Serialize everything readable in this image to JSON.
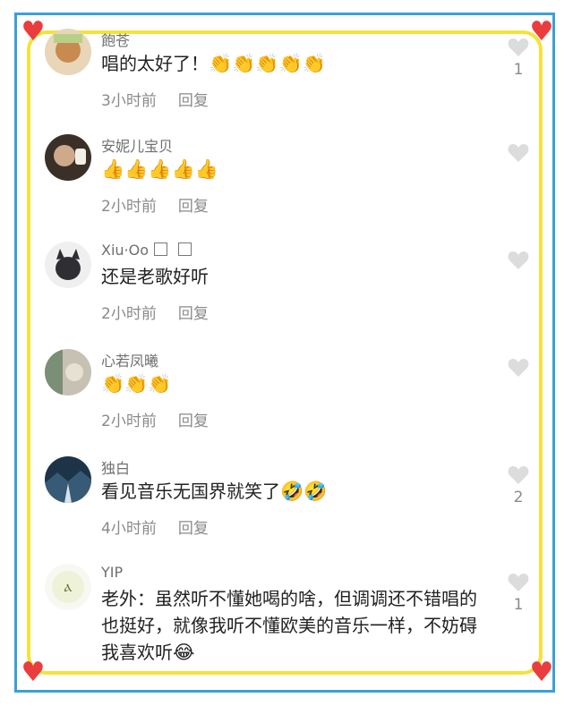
{
  "colors": {
    "frame_outer": "#3aa0d8",
    "frame_inner": "#f4e23c",
    "hearts": "#ea3d3d",
    "like_icon": "#dcdcdc"
  },
  "comments": [
    {
      "username": "飽苍",
      "text": "唱的太好了！",
      "emoji": "👏👏👏👏👏",
      "time": "3小时前",
      "reply": "回复",
      "likes": "1"
    },
    {
      "username": "安妮儿宝贝",
      "text": "",
      "emoji": "👍👍👍👍👍",
      "time": "2小时前",
      "reply": "回复",
      "likes": ""
    },
    {
      "username": "Xiu·Oo",
      "text": "还是老歌好听",
      "emoji": "",
      "time": "2小时前",
      "reply": "回复",
      "likes": ""
    },
    {
      "username": "心若凤曦",
      "text": "",
      "emoji": "👏👏👏",
      "time": "2小时前",
      "reply": "回复",
      "likes": ""
    },
    {
      "username": "独白",
      "text": "看见音乐无国界就笑了",
      "emoji": "🤣🤣",
      "time": "4小时前",
      "reply": "回复",
      "likes": "2"
    },
    {
      "username": "YIP",
      "text": "老外：虽然听不懂她喝的啥，但调调还不错唱的也挺好，就像我听不懂欧美的音乐一样，不妨碍我喜欢听",
      "emoji": "😂",
      "time": "",
      "reply": "",
      "likes": "1"
    }
  ]
}
